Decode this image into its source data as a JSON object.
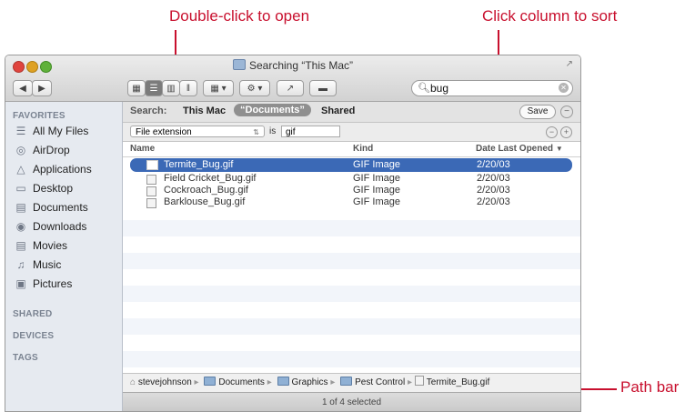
{
  "callouts": {
    "double_click": "Double-click to open",
    "click_column": "Click column to sort",
    "path_bar": "Path bar"
  },
  "window": {
    "title": "Searching “This Mac”"
  },
  "toolbar": {
    "back_label": "◀",
    "forward_label": "▶",
    "search_value": "bug"
  },
  "sidebar": {
    "favorites_header": "FAVORITES",
    "favorites": [
      {
        "label": "All My Files",
        "icon": "all-files-icon"
      },
      {
        "label": "AirDrop",
        "icon": "airdrop-icon"
      },
      {
        "label": "Applications",
        "icon": "applications-icon"
      },
      {
        "label": "Desktop",
        "icon": "desktop-icon"
      },
      {
        "label": "Documents",
        "icon": "documents-icon"
      },
      {
        "label": "Downloads",
        "icon": "downloads-icon"
      },
      {
        "label": "Movies",
        "icon": "movies-icon"
      },
      {
        "label": "Music",
        "icon": "music-icon"
      },
      {
        "label": "Pictures",
        "icon": "pictures-icon"
      }
    ],
    "shared_header": "SHARED",
    "devices_header": "DEVICES",
    "tags_header": "TAGS"
  },
  "scope": {
    "label": "Search:",
    "this_mac": "This Mac",
    "documents": "“Documents”",
    "shared": "Shared",
    "save": "Save"
  },
  "criteria": {
    "attribute": "File extension",
    "operator": "is",
    "value": "gif"
  },
  "columns": {
    "name": "Name",
    "kind": "Kind",
    "date": "Date Last Opened"
  },
  "files": [
    {
      "name": "Termite_Bug.gif",
      "kind": "GIF Image",
      "date": "2/20/03"
    },
    {
      "name": "Field Cricket_Bug.gif",
      "kind": "GIF Image",
      "date": "2/20/03"
    },
    {
      "name": "Cockroach_Bug.gif",
      "kind": "GIF Image",
      "date": "2/20/03"
    },
    {
      "name": "Barklouse_Bug.gif",
      "kind": "GIF Image",
      "date": "2/20/03"
    }
  ],
  "path": [
    "stevejohnson",
    "Documents",
    "Graphics",
    "Pest Control",
    "Termite_Bug.gif"
  ],
  "status": "1 of 4 selected",
  "colors": {
    "accent": "#c8102e",
    "selection": "#3b69b6"
  }
}
